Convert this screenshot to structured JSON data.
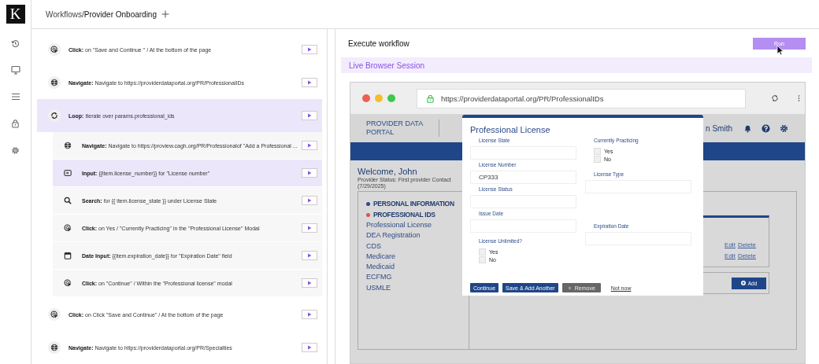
{
  "rail": {
    "logo": "K",
    "icons": [
      {
        "kind": "history"
      },
      {
        "kind": "monitor"
      },
      {
        "kind": "menu"
      },
      {
        "kind": "lock"
      },
      {
        "kind": "settings"
      }
    ]
  },
  "breadcrumb": {
    "path": "Workflows/",
    "current": "Provider Onboarding"
  },
  "steps": [
    {
      "kind": "click",
      "text": "**Click:** on \"Save and Continue \" / At the bottom of the page",
      "selected": false
    },
    {
      "kind": "navigate",
      "text": "**Navigate:** Navigate to https://providerdataportal.org/PR/ProfessionalIDs",
      "selected": false
    },
    {
      "kind": "loop",
      "text": "**Loop:** Iterate over params.professional_ids",
      "selected": true,
      "children": [
        {
          "kind": "navigate",
          "text": "**Navigate:** Navigate to https://proview.cagh.org/PR/Professionalof \"Add a Professional ...",
          "selected": false
        },
        {
          "kind": "input",
          "text": "**Input:** {{item.license_number}} for \"License number\"",
          "selected": true
        },
        {
          "kind": "search",
          "text": "**Search:** for {{ item.license_state }} under License State",
          "selected": false
        },
        {
          "kind": "click",
          "text": "**Click:** on Yes / \"Currently Practicing\" in the \"Professional License\" Modal",
          "selected": false
        },
        {
          "kind": "date",
          "text": "**Date Input:** {{item.expiration_date}} for \"Expiration Date\" field",
          "selected": false
        },
        {
          "kind": "click",
          "text": "**Click:** on \"Continue\" / Within the \"Professional license\" modal",
          "selected": false
        }
      ]
    },
    {
      "kind": "click",
      "text": "**Click:** on Click \"Save and Continue\" / At the bottom of the page",
      "selected": false
    },
    {
      "kind": "navigate",
      "text": "**Navigate:** Navigate to https://providerdataportal.org/PR/Specialties",
      "selected": false
    }
  ],
  "execute": {
    "title": "Execute workflow",
    "run_button": "Run"
  },
  "session": {
    "title": "Live Browser Session",
    "url": "https://providerdataportal.org/PR/ProfessionalIDs"
  },
  "portal": {
    "brand": "PROVIDER DATA PORTAL",
    "user": "n Smith",
    "welcome": "Welcome, John",
    "status": "Provider Status: First provider Contact (7/29/2025)",
    "nav": [
      {
        "kind": "section",
        "label": "PERSONAL INFORMATION",
        "color": "#2f4a8a"
      },
      {
        "kind": "section",
        "label": "PROFESSIONAL IDS",
        "color": "#d9534f"
      },
      {
        "kind": "item",
        "label": "Professional License"
      },
      {
        "kind": "item",
        "label": "DEA Registration"
      },
      {
        "kind": "item",
        "label": "CDS"
      },
      {
        "kind": "item",
        "label": "Medicare"
      },
      {
        "kind": "item",
        "label": "Medicaid"
      },
      {
        "kind": "item",
        "label": "ECFMG"
      },
      {
        "kind": "item",
        "label": "USMLE"
      }
    ],
    "rows": [
      {
        "edit": "Edit",
        "delete": "Delete"
      },
      {
        "edit": "Edit",
        "delete": "Delete"
      }
    ],
    "add_button": "Add"
  },
  "modal": {
    "title": "Professional License",
    "left": [
      {
        "kind": "text",
        "label": "License State"
      },
      {
        "kind": "text",
        "label": "License Number",
        "value": "CP333"
      },
      {
        "kind": "text",
        "label": "License Status"
      },
      {
        "kind": "text",
        "label": "Issue Date"
      },
      {
        "kind": "choice",
        "label": "License Unlimited?",
        "options": [
          {
            "label": "Yes",
            "checked": false
          },
          {
            "label": "No",
            "checked": false
          }
        ]
      }
    ],
    "right": [
      {
        "kind": "choice",
        "label": "Currently Practicing",
        "options": [
          {
            "label": "Yes",
            "checked": false
          },
          {
            "label": "No",
            "checked": false
          }
        ]
      },
      {
        "kind": "text",
        "label": "License Type"
      },
      {
        "kind": "text",
        "label": "Expiration Date"
      }
    ],
    "buttons": [
      {
        "kind": "primary",
        "label": "Continue"
      },
      {
        "kind": "primary",
        "label": "Save & Add Another"
      },
      {
        "kind": "remove",
        "label": "Remove"
      },
      {
        "kind": "link",
        "label": "Not now"
      }
    ]
  }
}
